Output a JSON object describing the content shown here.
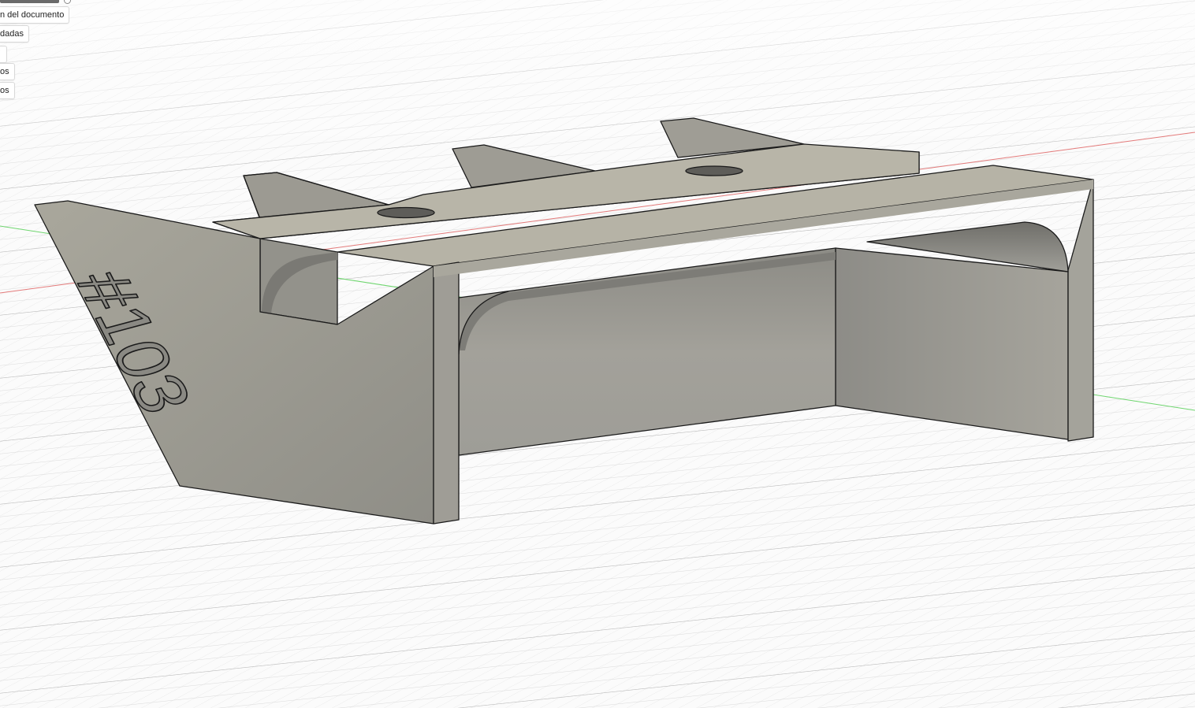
{
  "browser": {
    "items": [
      {
        "label": "n del documento"
      },
      {
        "label": "dadas"
      },
      {
        "label": "os"
      },
      {
        "label": "os"
      }
    ]
  },
  "model": {
    "engraved_text": "#103"
  },
  "colors": {
    "background": "#fbfbfb",
    "grid_line": "#c9c9c9",
    "x_axis": "#e05050",
    "y_axis": "#4ccd4c",
    "body_light": "#b7b4a8",
    "body_mid": "#a2a097",
    "body_dark": "#8d8c86",
    "edge": "#1a1a1a"
  }
}
